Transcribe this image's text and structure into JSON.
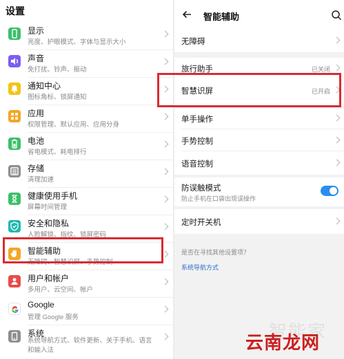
{
  "left": {
    "title": "设置",
    "items": [
      {
        "title": "显示",
        "subtitle": "亮度、护眼模式、字体与显示大小",
        "icon": "display-icon",
        "color": "#3cc06a"
      },
      {
        "title": "声音",
        "subtitle": "免打扰、铃声、振动",
        "icon": "sound-icon",
        "color": "#7d5df0"
      },
      {
        "title": "通知中心",
        "subtitle": "图标角标、锁屏通知",
        "icon": "notification-icon",
        "color": "#f2c417"
      },
      {
        "title": "应用",
        "subtitle": "权限管理、默认应用、应用分身",
        "icon": "apps-icon",
        "color": "#f5a623"
      },
      {
        "title": "电池",
        "subtitle": "省电模式、耗电排行",
        "icon": "battery-icon",
        "color": "#3cc06a"
      },
      {
        "title": "存储",
        "subtitle": "清理加速",
        "icon": "storage-icon",
        "color": "#8e8e93"
      },
      {
        "title": "健康使用手机",
        "subtitle": "屏幕时间管理",
        "icon": "hourglass-icon",
        "color": "#3cc06a"
      },
      {
        "title": "安全和隐私",
        "subtitle": "人脸解锁、指纹、锁屏密码",
        "icon": "shield-icon",
        "color": "#20b9b0"
      },
      {
        "title": "智能辅助",
        "subtitle": "无障碍、智慧识屏、手势控制",
        "icon": "hand-icon",
        "color": "#f5a623"
      },
      {
        "title": "用户和帐户",
        "subtitle": "多用户、云空间、帐户",
        "icon": "user-icon",
        "color": "#e94b4b"
      },
      {
        "title": "Google",
        "subtitle": "管理 Google 服务",
        "icon": "google-icon",
        "color": "#ffffff"
      },
      {
        "title": "系统",
        "subtitle": "系统导航方式、软件更新、关于手机、语言和输入法",
        "icon": "system-icon",
        "color": "#8e8e93"
      }
    ]
  },
  "right": {
    "title": "智能辅助",
    "rows": {
      "accessibility": {
        "label": "无障碍"
      },
      "travel": {
        "label": "旅行助手",
        "value": "已关闭"
      },
      "screen_recog": {
        "label": "智慧识屏",
        "value": "已开启"
      },
      "one_hand": {
        "label": "单手操作"
      },
      "gesture": {
        "label": "手势控制"
      },
      "voice": {
        "label": "语音控制"
      },
      "pocket": {
        "label": "防误触模式",
        "subtitle": "防止手机在口袋出现误操作",
        "enabled": true
      },
      "schedule": {
        "label": "定时开关机"
      }
    },
    "tips": {
      "question": "是否在寻找其他设置项？",
      "link": "系统导航方式"
    }
  },
  "watermark": {
    "faint": "智能家",
    "brand": "云南龙网"
  },
  "colors": {
    "highlight": "#d92b32",
    "toggle_on": "#2a8df0",
    "link": "#2a6fc7"
  }
}
